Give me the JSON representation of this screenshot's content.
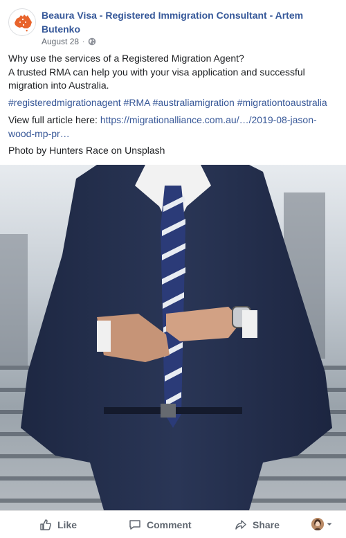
{
  "post": {
    "page_name": "Beaura Visa - Registered Immigration Consultant - Artem Butenko",
    "date": "August 28",
    "separator": "·",
    "privacy_icon": "globe-icon",
    "avatar_icon": "australia-map-logo",
    "body_lines": [
      "Why use the services of a Registered Migration Agent?",
      "A trusted RMA can help you with your visa application and successful migration into Australia."
    ],
    "hashtags": [
      "#registeredmigrationagent",
      "#RMA",
      "#australiamigration",
      "#migrationtoaustralia"
    ],
    "article_prefix": "View full article here: ",
    "article_link": "https://migrationalliance.com.au/…/2019-08-jason-wood-mp-pr…",
    "photo_credit": "Photo by Hunters Race on Unsplash",
    "photo_description_icon": "man-in-navy-suit-photo"
  },
  "actions": {
    "like_label": "Like",
    "comment_label": "Comment",
    "share_label": "Share",
    "like_icon": "thumbs-up-icon",
    "comment_icon": "speech-bubble-icon",
    "share_icon": "share-arrow-icon",
    "reaction_icon": "profile-avatar-dropdown"
  },
  "colors": {
    "link": "#385898",
    "page_name": "#365899",
    "meta": "#616770",
    "logo_orange": "#e8642c"
  }
}
